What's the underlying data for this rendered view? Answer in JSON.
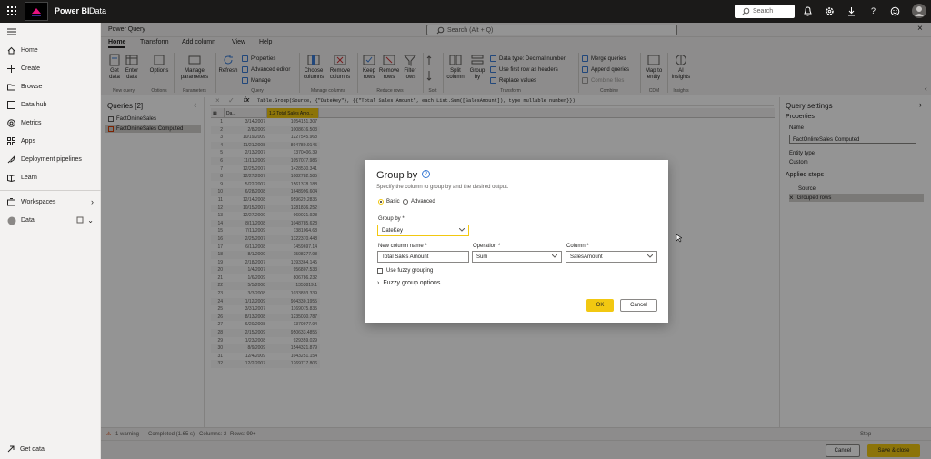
{
  "topbar": {
    "brand": "Power BI",
    "workspace": "Data",
    "search_placeholder": "Search"
  },
  "nav": {
    "items": [
      {
        "label": "Home"
      },
      {
        "label": "Create"
      },
      {
        "label": "Browse"
      },
      {
        "label": "Data hub"
      },
      {
        "label": "Metrics"
      },
      {
        "label": "Apps"
      },
      {
        "label": "Deployment pipelines"
      },
      {
        "label": "Learn"
      },
      {
        "label": "Workspaces"
      },
      {
        "label": "Data"
      }
    ],
    "get_data": "Get data"
  },
  "pq": {
    "title": "Power Query",
    "search": "Search (Alt + Q)",
    "tabs": [
      "Home",
      "Transform",
      "Add column",
      "View",
      "Help"
    ],
    "ribbon": {
      "get_data": "Get data",
      "enter_data": "Enter data",
      "options": "Options",
      "manage_parameters": "Manage parameters",
      "refresh": "Refresh",
      "properties": "Properties",
      "advanced_editor": "Advanced editor",
      "manage": "Manage",
      "choose_columns": "Choose columns",
      "remove_columns": "Remove columns",
      "keep_rows": "Keep rows",
      "remove_rows": "Remove rows",
      "filter_rows": "Filter rows",
      "split_column": "Split column",
      "group_by": "Group by",
      "data_type": "Data type: Decimal number",
      "first_row_headers": "Use first row as headers",
      "replace_values": "Replace values",
      "merge_queries": "Merge queries",
      "append_queries": "Append queries",
      "combine_files": "Combine files",
      "map_to_entity": "Map to entity",
      "ai_insights": "AI insights",
      "groups": [
        "New query",
        "Options",
        "Parameters",
        "Query",
        "Manage columns",
        "Reduce rows",
        "Sort",
        "Transform",
        "Combine",
        "CDM",
        "Insights"
      ]
    },
    "formula": "Table.Group(Source, {\"DateKey\"}, {{\"Total Sales Amount\", each List.Sum([SalesAmount]), type nullable number}})",
    "queries": {
      "title": "Queries [2]",
      "items": [
        "FactOnlineSales",
        "FactOnlineSales Computed"
      ]
    },
    "grid": {
      "col1": "Da...",
      "col2": "1.2 Total Sales Amo...",
      "rows": [
        [
          "1",
          "3/14/2007",
          "1054151.307"
        ],
        [
          "2",
          "2/8/2009",
          "1008616.503"
        ],
        [
          "3",
          "10/19/2009",
          "1227545.968"
        ],
        [
          "4",
          "11/21/2008",
          "804780.9145"
        ],
        [
          "5",
          "2/13/2007",
          "1370406.39"
        ],
        [
          "6",
          "11/11/2009",
          "1057077.986"
        ],
        [
          "7",
          "12/25/2007",
          "1428530.341"
        ],
        [
          "8",
          "12/27/2007",
          "1082782.585"
        ],
        [
          "9",
          "5/22/2007",
          "1561378.188"
        ],
        [
          "10",
          "6/28/2008",
          "1648996.604"
        ],
        [
          "11",
          "12/14/2008",
          "959629.2835"
        ],
        [
          "12",
          "10/15/2007",
          "1281836.252"
        ],
        [
          "13",
          "12/27/2009",
          "969021.928"
        ],
        [
          "14",
          "8/11/2008",
          "1048785.628"
        ],
        [
          "15",
          "7/11/2009",
          "1381064.68"
        ],
        [
          "16",
          "2/25/2007",
          "1322370.448"
        ],
        [
          "17",
          "6/11/2008",
          "1459697.14"
        ],
        [
          "18",
          "8/1/2009",
          "1508277.98"
        ],
        [
          "19",
          "2/18/2007",
          "1393364.145"
        ],
        [
          "20",
          "1/4/2007",
          "956807.533"
        ],
        [
          "21",
          "1/6/2009",
          "806786.232"
        ],
        [
          "22",
          "5/5/2008",
          "1353819.1"
        ],
        [
          "23",
          "3/3/2008",
          "1033893.339"
        ],
        [
          "24",
          "1/12/2009",
          "904330.1955"
        ],
        [
          "25",
          "3/31/2007",
          "1169075.835"
        ],
        [
          "26",
          "8/13/2008",
          "1235030.787"
        ],
        [
          "27",
          "6/20/2008",
          "1370977.94"
        ],
        [
          "28",
          "2/15/2009",
          "950633.4855"
        ],
        [
          "29",
          "1/23/2008",
          "929359.029"
        ],
        [
          "30",
          "8/9/2009",
          "1544321.879"
        ],
        [
          "31",
          "12/4/2009",
          "1043251.154"
        ],
        [
          "32",
          "12/2/2007",
          "1269717.806"
        ]
      ]
    },
    "settings": {
      "title": "Query settings",
      "properties": "Properties",
      "name_label": "Name",
      "name_value": "FactOnlineSales Computed",
      "entity_type_label": "Entity type",
      "entity_type_value": "Custom",
      "applied_steps": "Applied steps",
      "steps": [
        "Source",
        "Grouped rows"
      ]
    },
    "status": {
      "warning": "1 warning",
      "completed": "Completed (1.65 s)",
      "columns": "Columns: 2",
      "rows": "Rows: 99+",
      "step": "Step"
    },
    "footer": {
      "cancel": "Cancel",
      "save": "Save & close"
    }
  },
  "dialog": {
    "title": "Group by",
    "description": "Specify the column to group by and the desired output.",
    "mode_basic": "Basic",
    "mode_advanced": "Advanced",
    "group_by_label": "Group by *",
    "group_by_value": "DateKey",
    "new_col_label": "New column name *",
    "new_col_value": "Total Sales Amount",
    "operation_label": "Operation *",
    "operation_value": "Sum",
    "column_label": "Column *",
    "column_value": "SalesAmount",
    "fuzzy_check": "Use fuzzy grouping",
    "fuzzy_options": "Fuzzy group options",
    "ok": "OK",
    "cancel": "Cancel"
  },
  "colors": {
    "accent": "#f2c811",
    "topbar": "#1b1a19",
    "selection": "#d2d0ce"
  }
}
